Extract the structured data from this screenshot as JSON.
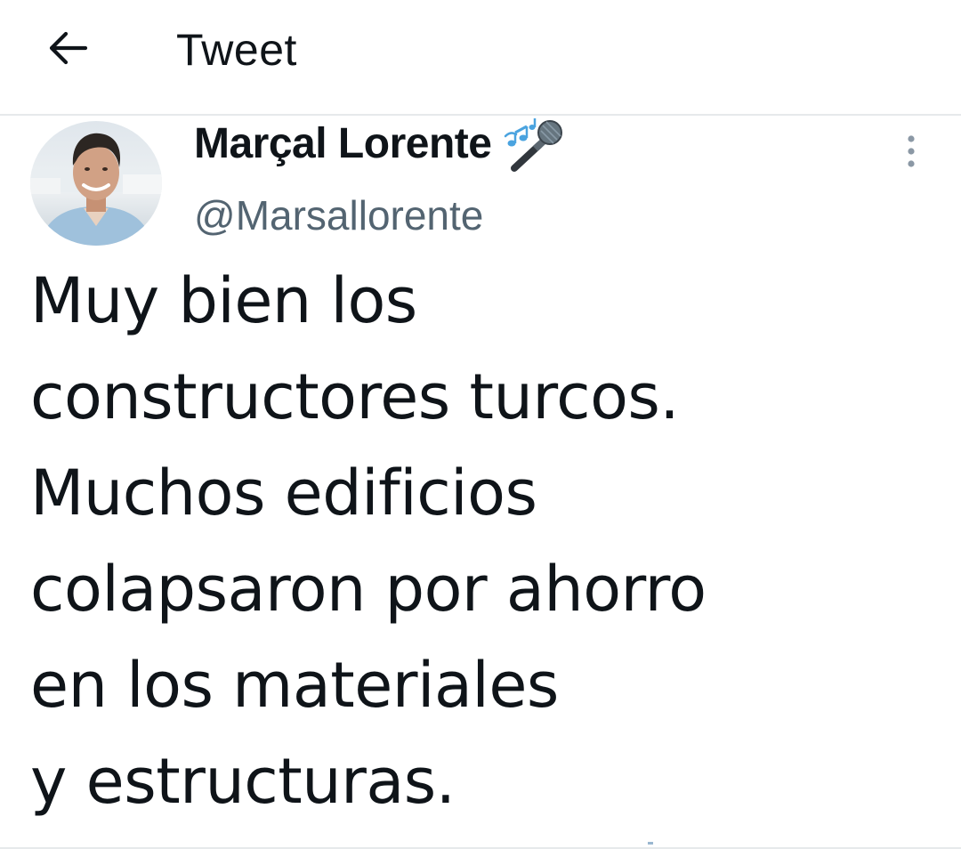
{
  "header": {
    "title": "Tweet",
    "back_icon": "arrow-left-icon"
  },
  "author": {
    "name": "Marçal Lorente",
    "name_emoji": "microphone-with-music-notes-icon",
    "handle": "@Marsallorente",
    "avatar": "profile-photo"
  },
  "more_icon": "vertical-ellipsis-icon",
  "tweet": {
    "text": "Muy bien los\nconstructores turcos.\nMuchos edificios\ncolapsaron por ahorro\nen los materiales\ny estructuras."
  },
  "colors": {
    "text_primary": "#0f1419",
    "text_secondary": "#536471",
    "divider": "#e6e9eb",
    "icon_gray": "#8b98a5"
  }
}
